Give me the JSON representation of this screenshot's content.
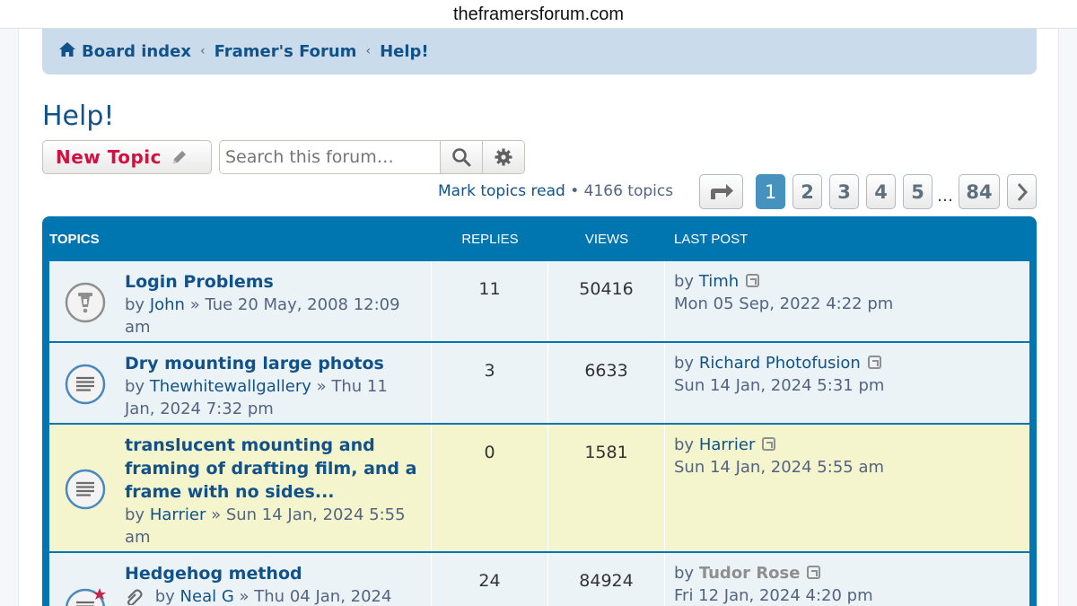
{
  "browser": {
    "url": "theframersforum.com"
  },
  "breadcrumbs": [
    "Board index",
    "Framer's Forum",
    "Help!"
  ],
  "forum": {
    "title": "Help!"
  },
  "actions": {
    "new_topic": "New Topic",
    "search_placeholder": "Search this forum…"
  },
  "summary": {
    "mark_read": "Mark topics read",
    "bullet": "•",
    "topic_count": "4166 topics"
  },
  "pagination": {
    "pages": [
      "1",
      "2",
      "3",
      "4",
      "5",
      "84"
    ],
    "current": "1",
    "ellipsis": "…"
  },
  "table": {
    "headers": {
      "topics": "TOPICS",
      "replies": "REPLIES",
      "views": "VIEWS",
      "last_post": "LAST POST"
    },
    "rows": [
      {
        "title": "Login Problems",
        "by": "by",
        "author": "John",
        "sep": "»",
        "date_line1": "Tue 20 May, 2008 12:09",
        "date_line2": "am",
        "replies": "11",
        "views": "50416",
        "last_by": "by",
        "last_author": "Timh",
        "last_date": "Mon 05 Sep, 2022 4:22 pm",
        "icon": "announcement-icon"
      },
      {
        "title": "Dry mounting large photos",
        "by": "by",
        "author": "Thewhitewallgallery",
        "sep": "»",
        "date_line1": "Thu 11",
        "date_line2": "Jan, 2024 7:32 pm",
        "replies": "3",
        "views": "6633",
        "last_by": "by",
        "last_author": "Richard Photofusion",
        "last_date": "Sun 14 Jan, 2024 5:31 pm",
        "icon": "topic-read-icon"
      },
      {
        "title_lines": [
          "translucent mounting and",
          "framing of drafting film, and a",
          "frame with no sides..."
        ],
        "by": "by",
        "author": "Harrier",
        "sep": "»",
        "date_line1": "Sun 14 Jan, 2024 5:55",
        "date_line2": "am",
        "replies": "0",
        "views": "1581",
        "last_by": "by",
        "last_author": "Harrier",
        "last_date": "Sun 14 Jan, 2024 5:55 am",
        "icon": "topic-read-icon"
      },
      {
        "title": "Hedgehog method",
        "by": "by",
        "author": "Neal G",
        "sep": "»",
        "date_line1": "Thu 04 Jan, 2024",
        "replies": "24",
        "views": "84924",
        "last_by": "by",
        "last_author": "Tudor Rose",
        "last_date": "Fri 12 Jan, 2024 4:20 pm",
        "icon": "hot-topic-icon"
      }
    ]
  },
  "colors": {
    "brand_blue": "#0076b1",
    "link": "#105289",
    "new_topic_red": "#d31141",
    "sticky_row": "#f4f4cd",
    "row": "#ecf3f7"
  }
}
